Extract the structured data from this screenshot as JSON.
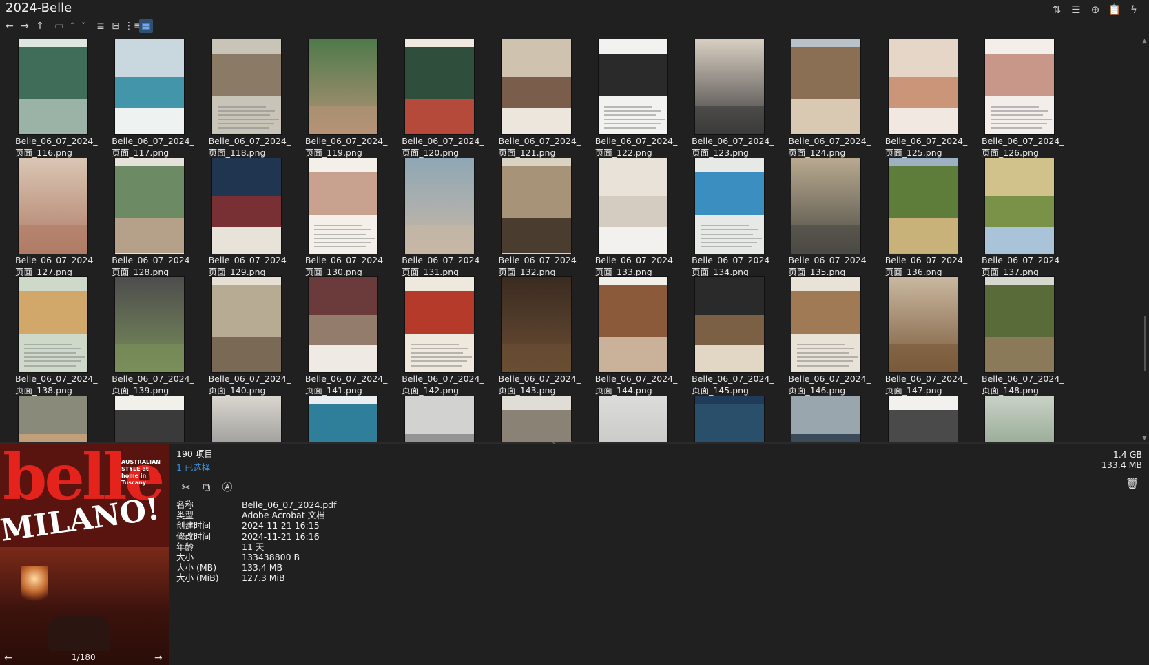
{
  "window": {
    "title": "2024-Belle"
  },
  "top_icons": [
    {
      "name": "sort-icon",
      "glyph": "⇅"
    },
    {
      "name": "list-options-icon",
      "glyph": "☰"
    },
    {
      "name": "add-circle-icon",
      "glyph": "⊕"
    },
    {
      "name": "clipboard-icon",
      "glyph": "📋"
    },
    {
      "name": "lightning-icon",
      "glyph": "ϟ"
    }
  ],
  "toolbar": [
    {
      "name": "back-arrow-icon",
      "glyph": "←"
    },
    {
      "name": "forward-arrow-icon",
      "glyph": "→"
    },
    {
      "name": "up-arrow-icon",
      "glyph": "↑"
    },
    {
      "name": "folder-window-icon",
      "glyph": "▭"
    },
    {
      "name": "chevron-up-icon",
      "glyph": "˄"
    },
    {
      "name": "chevron-down-icon",
      "glyph": "˅"
    },
    {
      "name": "details-view-icon",
      "glyph": "≣"
    },
    {
      "name": "tiles-view-icon",
      "glyph": "⊟"
    },
    {
      "name": "tree-view-icon",
      "glyph": "⋮≡"
    },
    {
      "name": "thumbnails-view-icon",
      "glyph": "▦"
    }
  ],
  "files": [
    "Belle_06_07_2024_页面_116.png",
    "Belle_06_07_2024_页面_117.png",
    "Belle_06_07_2024_页面_118.png",
    "Belle_06_07_2024_页面_119.png",
    "Belle_06_07_2024_页面_120.png",
    "Belle_06_07_2024_页面_121.png",
    "Belle_06_07_2024_页面_122.png",
    "Belle_06_07_2024_页面_123.png",
    "Belle_06_07_2024_页面_124.png",
    "Belle_06_07_2024_页面_125.png",
    "Belle_06_07_2024_页面_126.png",
    "Belle_06_07_2024_页面_127.png",
    "Belle_06_07_2024_页面_128.png",
    "Belle_06_07_2024_页面_129.png",
    "Belle_06_07_2024_页面_130.png",
    "Belle_06_07_2024_页面_131.png",
    "Belle_06_07_2024_页面_132.png",
    "Belle_06_07_2024_页面_133.png",
    "Belle_06_07_2024_页面_134.png",
    "Belle_06_07_2024_页面_135.png",
    "Belle_06_07_2024_页面_136.png",
    "Belle_06_07_2024_页面_137.png",
    "Belle_06_07_2024_页面_138.png",
    "Belle_06_07_2024_页面_139.png",
    "Belle_06_07_2024_页面_140.png",
    "Belle_06_07_2024_页面_141.png",
    "Belle_06_07_2024_页面_142.png",
    "Belle_06_07_2024_页面_143.png",
    "Belle_06_07_2024_页面_144.png",
    "Belle_06_07_2024_页面_145.png",
    "Belle_06_07_2024_页面_146.png",
    "Belle_06_07_2024_页面_147.png",
    "Belle_06_07_2024_页面_148.png",
    "",
    "",
    "",
    "",
    "",
    "",
    "",
    "",
    "",
    "",
    ""
  ],
  "thumb_palettes": [
    [
      "#dfe6e0",
      "#3f6d5a",
      "#9bb3a6"
    ],
    [
      "#eef2f0",
      "#2b8aa0",
      "#c8d8de"
    ],
    [
      "#c9c4b8",
      "#8a7a66",
      "#7f9a5a"
    ],
    [
      "#e8e8e6",
      "#b69377",
      "#4f7a4b"
    ],
    [
      "#efe9df",
      "#2f4f3c",
      "#b54a3a"
    ],
    [
      "#ece6dc",
      "#6b4b3a",
      "#cfc3b0"
    ],
    [
      "#f2f2f0",
      "#2a2a2a",
      "#bdbdbd"
    ],
    [
      "#f0eeea",
      "#3a3a3a",
      "#d8cfc2"
    ],
    [
      "#b9c2c9",
      "#8a6f55",
      "#d9c9b3"
    ],
    [
      "#f1e8e2",
      "#c48a6a",
      "#e6d6c8"
    ],
    [
      "#f3eeea",
      "#c9968a",
      "#e8e2dc"
    ],
    [
      "#efe9e4",
      "#b07c66",
      "#d9c6b4"
    ],
    [
      "#e6e2da",
      "#6c8a64",
      "#b5a08a"
    ],
    [
      "#e8e3d9",
      "#8a2f2f",
      "#1f3550"
    ],
    [
      "#f4efe9",
      "#c9a28f",
      "#e0a39a"
    ],
    [
      "#f1ede7",
      "#c8b7a5",
      "#8fa7b5"
    ],
    [
      "#d9d3c4",
      "#a69378",
      "#4a3d30"
    ],
    [
      "#f3f1ee",
      "#d0c8bc",
      "#e8e2d8"
    ],
    [
      "#e7e9e6",
      "#3a8fc0",
      "#5f7d4a"
    ],
    [
      "#eeeae2",
      "#4b4a44",
      "#b8a98f"
    ],
    [
      "#9cb2c2",
      "#5f7d3a",
      "#c9b27a"
    ],
    [
      "#a9c4d8",
      "#6b8a3c",
      "#d0c28a"
    ],
    [
      "#cfd9c9",
      "#d1a76a",
      "#6f8a4a"
    ],
    [
      "#d8c6b0",
      "#7a8f5a",
      "#4d4d4d"
    ],
    [
      "#e6dfd3",
      "#b8ab94",
      "#7a6a55"
    ],
    [
      "#efebe4",
      "#9a8876",
      "#6b3a3a"
    ],
    [
      "#efe8dd",
      "#b63a2a",
      "#2a4f8a"
    ],
    [
      "#c9c3b5",
      "#6b4e34",
      "#3a2b20"
    ],
    [
      "#f2efea",
      "#8a5a3a",
      "#c9b19a"
    ],
    [
      "#e2d6c4",
      "#8a6a4a",
      "#2a2a2a"
    ],
    [
      "#e9e2d6",
      "#a07a55",
      "#d8cdb9"
    ],
    [
      "#e4d8c6",
      "#7a5a3a",
      "#c9b8a0"
    ],
    [
      "#d6d8cf",
      "#5a6b3a",
      "#8a7a5a"
    ],
    [
      "#f0ede6",
      "#c9a27a",
      "#8a8a7a"
    ],
    [
      "#f2f0ea",
      "#3a3a3a",
      "#c9c3b8"
    ],
    [
      "#f3f2ef",
      "#6b6b6b",
      "#d9d6cf"
    ],
    [
      "#eaeef1",
      "#2f7f9a",
      "#ffffff"
    ],
    [
      "#ededeb",
      "#8a8a8a",
      "#d2d2d0"
    ],
    [
      "#e0ddd6",
      "#8a8275",
      "#c8c3b8"
    ],
    [
      "#f1f1ef",
      "#b9b9b6",
      "#dcdcda"
    ],
    [
      "#1f3a5a",
      "#2a4f6b",
      "#3f6a8a"
    ],
    [
      "#f0efec",
      "#2a3a4a",
      "#9aa6ad"
    ],
    [
      "#f2f1ee",
      "#4a4a4a",
      "#c9c6bf"
    ],
    [
      "#e9ece8",
      "#6b8a6b",
      "#c9d1c6"
    ]
  ],
  "status": {
    "item_count": "190 项目",
    "selected": "1 已选择",
    "total_size": "1.4 GB",
    "selected_size": "133.4 MB"
  },
  "actions": [
    {
      "name": "cut-icon",
      "glyph": "✂"
    },
    {
      "name": "copy-icon",
      "glyph": "⧉"
    },
    {
      "name": "rename-icon",
      "glyph": "Ⓐ"
    }
  ],
  "properties": [
    {
      "key": "名称",
      "value": "Belle_06_07_2024.pdf"
    },
    {
      "key": "类型",
      "value": "Adobe Acrobat 文档"
    },
    {
      "key": "创建时间",
      "value": "2024-11-21  16:15"
    },
    {
      "key": "修改时间",
      "value": "2024-11-21  16:16"
    },
    {
      "key": "年龄",
      "value": "11 天"
    },
    {
      "key": "大小",
      "value": "133438800 B"
    },
    {
      "key": "大小 (MB)",
      "value": "133.4 MB"
    },
    {
      "key": "大小 (MiB)",
      "value": "127.3 MiB"
    }
  ],
  "preview": {
    "cover_title": "belle",
    "cover_headline": "MILANO!",
    "cover_sideline": "AUSTRALIAN STYLE at home in Tuscany",
    "page_indicator": "1/180",
    "prev_glyph": "←",
    "next_glyph": "→"
  },
  "trash_glyph": "🗑"
}
